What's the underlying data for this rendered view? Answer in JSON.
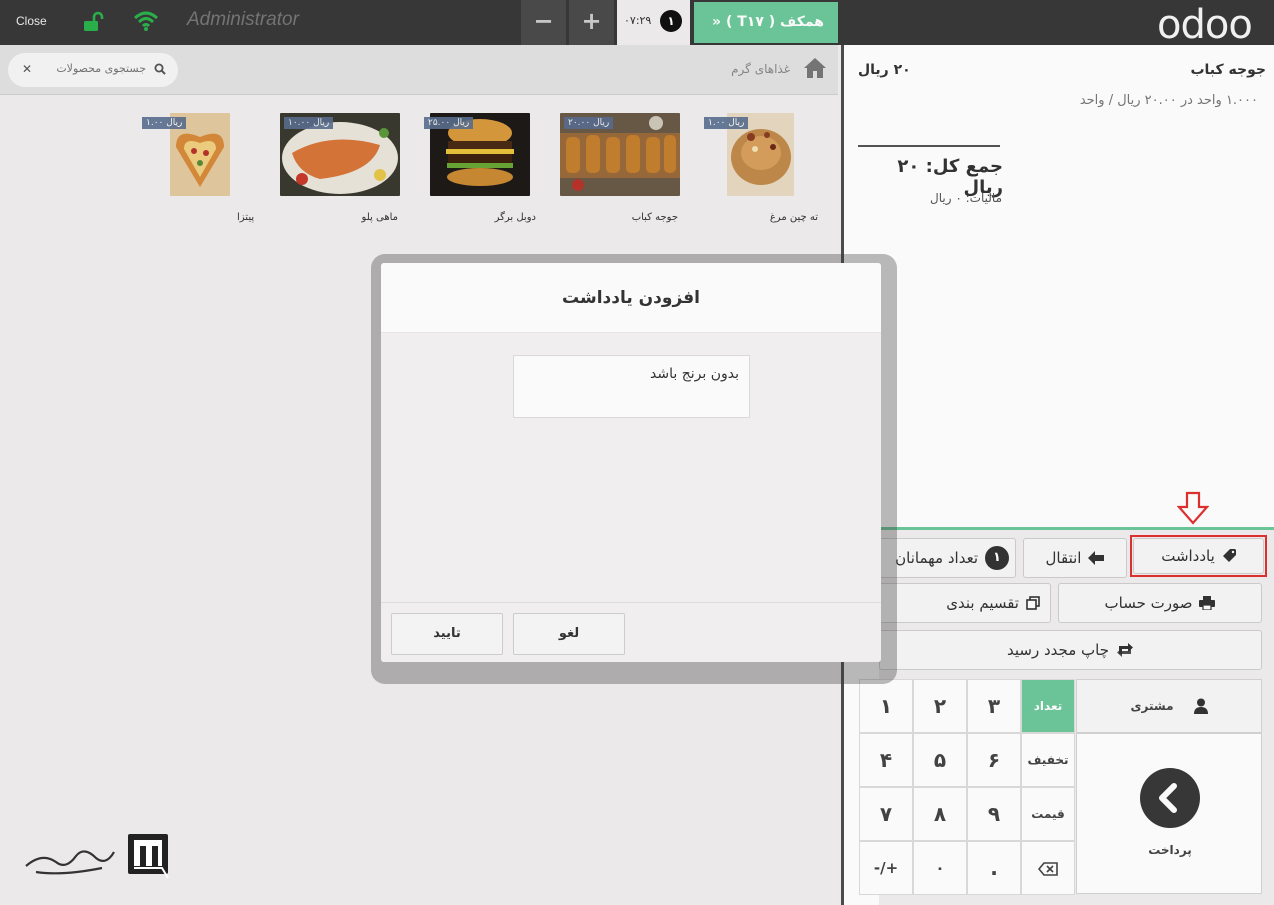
{
  "topbar": {
    "close_label": "Close",
    "username": "Administrator",
    "minus_label": "−",
    "plus_label": "+",
    "order_time": "۰۷:۲۹",
    "order_count": "۱",
    "floor_label": "همکف ( T۱۷ )",
    "logo": "odoo",
    "icons": [
      "lock-open-icon",
      "wifi-icon"
    ],
    "colors": {
      "accent": "#6ec89b",
      "bar": "#393939",
      "lock": "#2bb24c"
    }
  },
  "products_pane": {
    "category": "غذاهای گرم",
    "search_placeholder": "جستجوی محصولات",
    "products": [
      {
        "name": "ته چین مرغ",
        "price": "۱.۰۰ ریال"
      },
      {
        "name": "جوجه کباب",
        "price": "۲۰.۰۰ ریال"
      },
      {
        "name": "دوبل برگر",
        "price": "۲۵.۰۰ ریال"
      },
      {
        "name": "ماهی پلو",
        "price": "۱۰.۰۰ ریال"
      },
      {
        "name": "پیتزا",
        "price": "۱.۰۰ ریال"
      }
    ]
  },
  "order": {
    "line_name": "جوجه کباب",
    "line_price": "۲۰ ریال",
    "line_detail": "۱.۰۰۰ واحد در ۲۰.۰۰ ریال / واحد",
    "total": "جمع کل: ۲۰ ریال",
    "tax": "مالیات: ۰ ریال"
  },
  "controls": {
    "note": "یادداشت",
    "transfer": "انتقال",
    "guests": "تعداد مهمانان",
    "guests_count": "۱",
    "bill": "صورت حساب",
    "split": "تقسیم بندی",
    "reprint": "چاپ مجدد رسید",
    "customer": "مشتری",
    "payment": "پرداخت"
  },
  "numpad": {
    "keys": [
      "۱",
      "۲",
      "۳",
      "۴",
      "۵",
      "۶",
      "۷",
      "۸",
      "۹",
      "-/+",
      "۰",
      "."
    ],
    "modes": [
      "تعداد",
      "تخفیف",
      "قیمت"
    ],
    "active_mode": "تعداد"
  },
  "modal": {
    "title": "افزودن یادداشت",
    "note_value": "بدون برنج باشد",
    "confirm_label": "تایید",
    "cancel_label": "لغو"
  }
}
